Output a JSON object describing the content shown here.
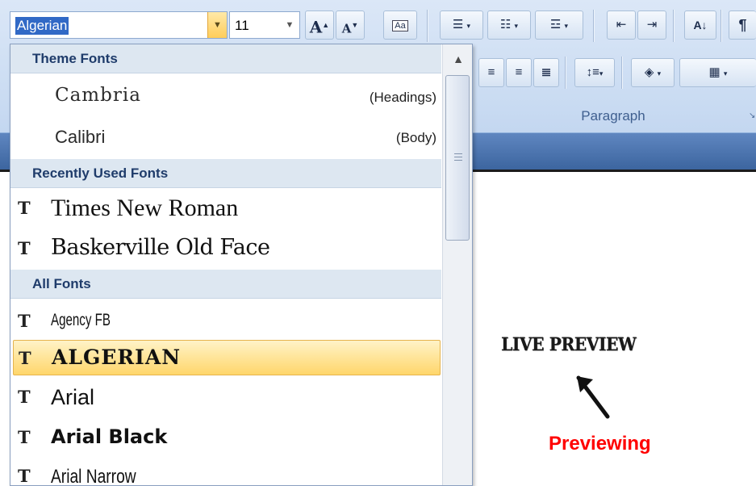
{
  "ribbon": {
    "font_name": "Algerian",
    "font_size": "11",
    "grow_font": "A",
    "shrink_font": "A",
    "clear_format": "Aa",
    "paragraph_group_label": "Paragraph",
    "show_marks": "¶",
    "sort": "A↓"
  },
  "font_menu": {
    "theme_header": "Theme Fonts",
    "theme_fonts": [
      {
        "name": "Cambria",
        "tag": "(Headings)"
      },
      {
        "name": "Calibri",
        "tag": "(Body)"
      }
    ],
    "recent_header": "Recently Used Fonts",
    "recent_fonts": [
      "Times New Roman",
      "Baskerville Old Face"
    ],
    "all_header": "All Fonts",
    "all_fonts": [
      "Agency FB",
      "ALGERIAN",
      "Arial",
      "Arial Black",
      "Arial Narrow"
    ],
    "truetype_glyph": "T",
    "selected": "ALGERIAN"
  },
  "document": {
    "live_preview": "LIVE PREVIEW",
    "previewing": "Previewing"
  },
  "colors": {
    "highlight": "#ffd66b",
    "header_bg": "#dde7f1",
    "header_text": "#1f3c6b",
    "previewing_text": "#ff0000",
    "ribbon_tab_strip": "#4a72ad"
  }
}
